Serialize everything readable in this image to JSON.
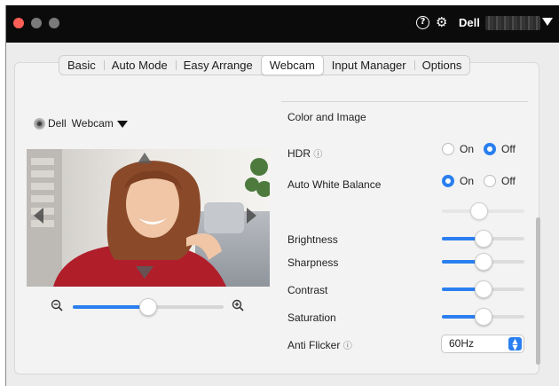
{
  "titlebar": {
    "brand": "Dell",
    "help_icon": "help-circle-icon",
    "settings_icon": "gear-icon"
  },
  "tabs": [
    {
      "label": "Basic",
      "active": false
    },
    {
      "label": "Auto Mode",
      "active": false
    },
    {
      "label": "Easy Arrange",
      "active": false
    },
    {
      "label": "Webcam",
      "active": true
    },
    {
      "label": "Input Manager",
      "active": false
    },
    {
      "label": "Options",
      "active": false
    }
  ],
  "webcam": {
    "brand": "Dell",
    "name": "Webcam",
    "zoom_level": 0.5
  },
  "settings": {
    "section_title": "Color and Image",
    "hdr": {
      "label": "HDR",
      "on_label": "On",
      "off_label": "Off",
      "value": "Off"
    },
    "awb": {
      "label": "Auto White Balance",
      "on_label": "On",
      "off_label": "Off",
      "value": "On",
      "level": 0.45
    },
    "brightness": {
      "label": "Brightness",
      "level": 0.5
    },
    "sharpness": {
      "label": "Sharpness",
      "level": 0.5
    },
    "contrast": {
      "label": "Contrast",
      "level": 0.5
    },
    "saturation": {
      "label": "Saturation",
      "level": 0.5
    },
    "anti_flicker": {
      "label": "Anti Flicker",
      "value": "60Hz"
    }
  },
  "colors": {
    "accent": "#2a7ff0",
    "close": "#ff5f57",
    "titlebar": "#0b0b0b"
  }
}
